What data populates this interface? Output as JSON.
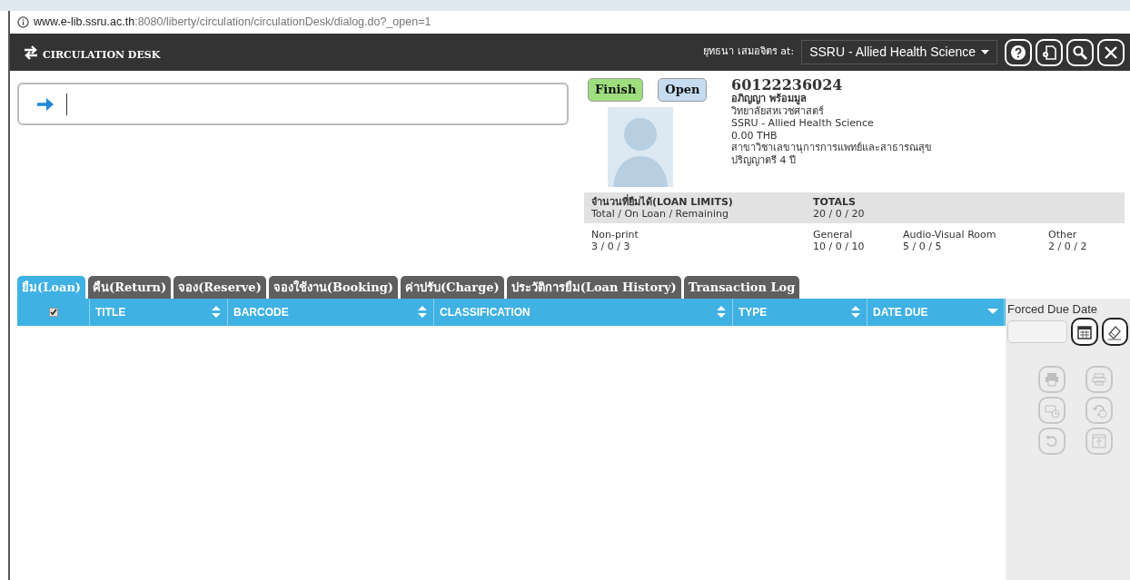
{
  "address_bar": {
    "url": "www.e-lib.ssru.ac.th:8080/liberty/circulation/circulationDesk/dialog.do?_open=1"
  },
  "header": {
    "title": "CIRCULATION DESK",
    "user_label": "ยุทธนา เสมอจิตร at:",
    "location": "SSRU - Allied Health Science",
    "buttons": [
      {
        "kind": "help"
      },
      {
        "kind": "settings"
      },
      {
        "kind": "search"
      },
      {
        "kind": "close"
      }
    ]
  },
  "patron_buttons": [
    {
      "label": "Finish",
      "kind": "finish"
    },
    {
      "label": "Open",
      "kind": "open"
    }
  ],
  "patron": {
    "barcode": "60122236024",
    "name": "อภิญญา พร้อมมูล",
    "details": [
      "วิทยาลัยสหเวชศาสตร์",
      "SSRU - Allied Health Science",
      "0.00 THB",
      "สาขาวิชาเลขานุการการแพทย์และสาธารณสุข",
      "ปริญญาตรี 4 ปี"
    ]
  },
  "loan_limits": {
    "title": "จำนวนที่ยืมได้(LOAN LIMITS)",
    "subtitle": "Total / On Loan / Remaining",
    "totals_label": "TOTALS",
    "totals_value": "20 / 0 / 20",
    "categories": [
      {
        "name": "Non-print",
        "value": "3 / 0 / 3"
      },
      {
        "name": "General",
        "value": "10 / 0 / 10"
      },
      {
        "name": "Audio-Visual Room",
        "value": "5 / 0 / 5"
      },
      {
        "name": "Other",
        "value": "2 / 0 / 2"
      }
    ]
  },
  "tabs": [
    {
      "label": "ยืม(Loan)",
      "selected": true
    },
    {
      "label": "คืน(Return)",
      "selected": false
    },
    {
      "label": "จอง(Reserve)",
      "selected": false
    },
    {
      "label": "จองใช้งาน(Booking)",
      "selected": false
    },
    {
      "label": "ค่าปรับ(Charge)",
      "selected": false
    },
    {
      "label": "ประวัติการยืม(Loan History)",
      "selected": false
    },
    {
      "label": "Transaction Log",
      "selected": false
    }
  ],
  "table": {
    "select_all_checked": true,
    "columns": [
      {
        "label": "TITLE",
        "sorted_descending": false
      },
      {
        "label": "BARCODE",
        "sorted_descending": false
      },
      {
        "label": "CLASSIFICATION",
        "sorted_descending": false
      },
      {
        "label": "TYPE",
        "sorted_descending": false
      },
      {
        "label": "DATE DUE",
        "sorted_descending": true
      }
    ]
  },
  "sidebar": {
    "forced_due_label": "Forced Due Date",
    "actions": [
      {
        "kind": "print-filled",
        "disabled": true
      },
      {
        "kind": "print",
        "disabled": true
      },
      {
        "kind": "print-clock",
        "disabled": true
      },
      {
        "kind": "renew-clock",
        "disabled": true
      },
      {
        "kind": "undo",
        "disabled": true
      },
      {
        "kind": "export",
        "disabled": true
      }
    ]
  }
}
